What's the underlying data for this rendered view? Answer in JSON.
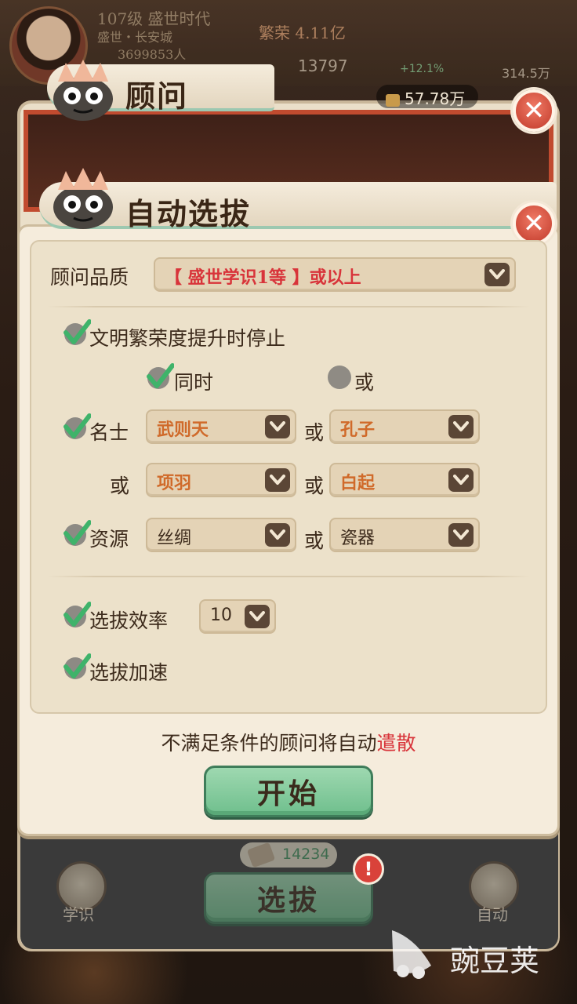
{
  "header": {
    "level_title": "107级 盛世时代",
    "server_line": "盛世・长安城",
    "population": "3699853人",
    "wealth": "繁荣 4.11亿",
    "stat_a": "13797",
    "stat_b": "+12.1%",
    "stat_c": "314.5万",
    "gold": "57.78万"
  },
  "outer_panel": {
    "title": "顾问"
  },
  "dialog": {
    "title": "自动选拔",
    "quality_label": "顾问品质",
    "quality_value": "【 盛世学识1等 】或以上",
    "stop_label": "文明繁荣度提升时停止",
    "mode_same": "同时",
    "mode_or": "或",
    "famous_label": "名士",
    "famous_1": "武则天",
    "famous_2": "孔子",
    "famous_3": "项羽",
    "famous_4": "白起",
    "or_text": "或",
    "resource_label": "资源",
    "resource_1": "丝绸",
    "resource_2": "瓷器",
    "efficiency_label": "选拔效率",
    "efficiency_value": "10",
    "speedup_label": "选拔加速",
    "note_prefix": "不满足条件的顾问将自动",
    "note_warn": "遣散",
    "start_label": "开始",
    "checks": {
      "stop": true,
      "same": true,
      "or": false,
      "famous": true,
      "resource": true,
      "efficiency": true,
      "speedup": true
    }
  },
  "bottom": {
    "scroll_count": "14234",
    "select_button": "选拔",
    "knowledge_label": "学识",
    "auto_label": "自动",
    "badge": "!"
  },
  "watermark": {
    "text": "豌豆荚"
  },
  "colors": {
    "accent_green": "#6fbf8d",
    "warn_red": "#d8343a",
    "value_orange": "#d06a2a",
    "check_green": "#3fb36a"
  }
}
